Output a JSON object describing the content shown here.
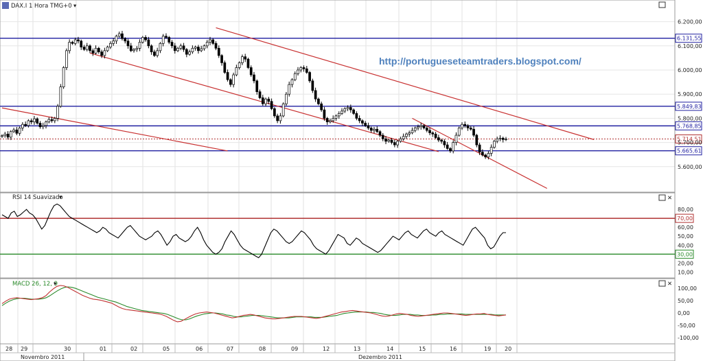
{
  "header": {
    "title": "DAX.I 1 Hora TMG+0",
    "watermark": "http://portugueseteamtraders.blogspot.com/"
  },
  "panels": {
    "price": {
      "y_min": 5500,
      "y_max": 6250,
      "ticks": [
        5600,
        5700,
        5800,
        5900,
        6000,
        6100,
        6200
      ],
      "tick_labels": [
        "5.600,00",
        "5.700,00",
        "5.800,00",
        "5.900,00",
        "6.000,00",
        "6.100,00",
        "6.200,00"
      ],
      "levels": [
        {
          "value": 6131.55,
          "label": "6.131,55",
          "color": "#1f1fa0",
          "style": "solid"
        },
        {
          "value": 5849.83,
          "label": "5.849,83",
          "color": "#1f1fa0",
          "style": "solid"
        },
        {
          "value": 5768.85,
          "label": "5.768,85",
          "color": "#1f1fa0",
          "style": "solid"
        },
        {
          "value": 5714.51,
          "label": "5.714,51",
          "color": "#b03030",
          "style": "dotted"
        },
        {
          "value": 5665.61,
          "label": "5.665,61",
          "color": "#1f1fa0",
          "style": "solid"
        }
      ],
      "trendlines": [
        {
          "from": {
            "t": 0,
            "y": 5843
          },
          "to": {
            "t": 77,
            "y": 5665
          }
        },
        {
          "from": {
            "t": 30,
            "y": 6070
          },
          "to": {
            "t": 149,
            "y": 5662
          }
        },
        {
          "from": {
            "t": 73,
            "y": 6175
          },
          "to": {
            "t": 202,
            "y": 5712
          }
        },
        {
          "from": {
            "t": 140,
            "y": 5800
          },
          "to": {
            "t": 186,
            "y": 5510
          }
        }
      ]
    },
    "rsi": {
      "title": "RSI 14 Suavizado",
      "y_min": 5,
      "y_max": 90,
      "ticks": [
        10,
        20,
        40,
        50,
        60,
        80
      ],
      "tick_labels": [
        "10,00",
        "20,00",
        "40,00",
        "50,00",
        "60,00",
        "80,00"
      ],
      "levels": [
        {
          "value": 70,
          "label": "70,00",
          "color": "#b03030"
        },
        {
          "value": 30,
          "label": "30,00",
          "color": "#2a8a2a"
        }
      ]
    },
    "macd": {
      "title": "MACD 26, 12, 9",
      "y_min": -120,
      "y_max": 120,
      "ticks": [
        -100,
        -50,
        0,
        50,
        100
      ],
      "tick_labels": [
        "-100,00",
        "-50,00",
        "0,00",
        "50,00",
        "100,00"
      ]
    }
  },
  "x_axis": {
    "days": [
      "28",
      "29",
      "30",
      "01",
      "02",
      "05",
      "06",
      "07",
      "08",
      "09",
      "12",
      "13",
      "14",
      "15",
      "16",
      "19",
      "20"
    ],
    "months": [
      "Novembro 2011",
      "Dezembro 2011"
    ]
  },
  "colors": {
    "up": "#ffffff",
    "down": "#000000",
    "level_blue": "#1f1fa0",
    "level_red": "#b03030",
    "macd": "#c03030",
    "signal": "#2a8a2a"
  },
  "chart_data": [
    {
      "type": "candlestick",
      "title": "DAX.I 1 Hora TMG+0",
      "ylim": [
        5500,
        6250
      ],
      "x_unit": "hourly bars",
      "close": [
        5728,
        5735,
        5722,
        5745,
        5752,
        5738,
        5760,
        5775,
        5770,
        5790,
        5785,
        5798,
        5780,
        5765,
        5770,
        5785,
        5795,
        5790,
        5800,
        5850,
        5930,
        6010,
        6080,
        6115,
        6110,
        6125,
        6120,
        6095,
        6085,
        6100,
        6080,
        6070,
        6090,
        6075,
        6060,
        6080,
        6095,
        6110,
        6120,
        6140,
        6150,
        6130,
        6120,
        6100,
        6080,
        6085,
        6090,
        6115,
        6135,
        6125,
        6100,
        6075,
        6060,
        6080,
        6110,
        6140,
        6135,
        6115,
        6100,
        6080,
        6090,
        6100,
        6085,
        6065,
        6075,
        6090,
        6095,
        6080,
        6088,
        6100,
        6115,
        6125,
        6110,
        6090,
        6060,
        6030,
        5990,
        5960,
        5940,
        5980,
        6010,
        6030,
        6055,
        6045,
        6010,
        5980,
        5955,
        5910,
        5885,
        5860,
        5880,
        5870,
        5840,
        5810,
        5790,
        5810,
        5860,
        5900,
        5940,
        5960,
        5985,
        6000,
        6010,
        6005,
        5990,
        5955,
        5915,
        5880,
        5860,
        5835,
        5800,
        5785,
        5790,
        5800,
        5810,
        5820,
        5830,
        5840,
        5845,
        5835,
        5820,
        5800,
        5790,
        5780,
        5770,
        5760,
        5750,
        5755,
        5745,
        5730,
        5715,
        5705,
        5710,
        5700,
        5690,
        5705,
        5715,
        5725,
        5735,
        5740,
        5750,
        5760,
        5765,
        5770,
        5760,
        5750,
        5740,
        5735,
        5720,
        5710,
        5705,
        5690,
        5675,
        5665,
        5700,
        5730,
        5760,
        5775,
        5770,
        5760,
        5755,
        5730,
        5690,
        5660,
        5648,
        5640,
        5655,
        5680,
        5705,
        5715,
        5718,
        5712,
        5714
      ],
      "open": [
        5725,
        5728,
        5735,
        5722,
        5745,
        5752,
        5738,
        5760,
        5775,
        5770,
        5790,
        5785,
        5798,
        5780,
        5765,
        5770,
        5785,
        5795,
        5790,
        5800,
        5850,
        5930,
        6010,
        6080,
        6115,
        6110,
        6125,
        6120,
        6095,
        6085,
        6100,
        6080,
        6070,
        6090,
        6075,
        6060,
        6080,
        6095,
        6110,
        6120,
        6140,
        6150,
        6130,
        6120,
        6100,
        6080,
        6085,
        6090,
        6115,
        6135,
        6125,
        6100,
        6075,
        6060,
        6080,
        6110,
        6140,
        6135,
        6115,
        6100,
        6080,
        6090,
        6100,
        6085,
        6065,
        6075,
        6090,
        6095,
        6080,
        6088,
        6100,
        6115,
        6125,
        6110,
        6090,
        6060,
        6030,
        5990,
        5960,
        5940,
        5980,
        6010,
        6030,
        6055,
        6045,
        6010,
        5980,
        5955,
        5910,
        5885,
        5860,
        5880,
        5870,
        5840,
        5810,
        5790,
        5810,
        5860,
        5900,
        5940,
        5960,
        5985,
        6000,
        6010,
        6005,
        5990,
        5955,
        5915,
        5880,
        5860,
        5835,
        5800,
        5785,
        5790,
        5800,
        5810,
        5820,
        5830,
        5840,
        5845,
        5835,
        5820,
        5800,
        5790,
        5780,
        5770,
        5760,
        5750,
        5755,
        5745,
        5730,
        5715,
        5705,
        5710,
        5700,
        5690,
        5705,
        5715,
        5725,
        5735,
        5740,
        5750,
        5760,
        5765,
        5770,
        5760,
        5750,
        5740,
        5735,
        5720,
        5710,
        5705,
        5690,
        5675,
        5665,
        5700,
        5730,
        5760,
        5775,
        5770,
        5760,
        5755,
        5730,
        5690,
        5660,
        5648,
        5640,
        5655,
        5680,
        5705,
        5715,
        5718,
        5712
      ]
    },
    {
      "type": "line",
      "title": "RSI 14 Suavizado",
      "ylim": [
        5,
        90
      ],
      "series": [
        {
          "values": [
            74,
            72,
            70,
            76,
            78,
            72,
            74,
            77,
            80,
            76,
            74,
            70,
            64,
            58,
            62,
            70,
            78,
            84,
            86,
            84,
            80,
            76,
            72,
            70,
            68,
            66,
            64,
            62,
            60,
            58,
            56,
            54,
            56,
            60,
            58,
            54,
            52,
            50,
            48,
            52,
            56,
            60,
            62,
            58,
            54,
            50,
            48,
            46,
            48,
            50,
            54,
            56,
            52,
            46,
            40,
            44,
            50,
            52,
            48,
            46,
            44,
            46,
            50,
            56,
            60,
            54,
            46,
            40,
            36,
            32,
            30,
            32,
            36,
            44,
            50,
            56,
            52,
            46,
            40,
            36,
            34,
            32,
            30,
            28,
            26,
            30,
            38,
            46,
            54,
            58,
            56,
            52,
            48,
            44,
            42,
            44,
            48,
            52,
            56,
            54,
            50,
            46,
            40,
            36,
            34,
            32,
            30,
            34,
            40,
            46,
            52,
            50,
            48,
            42,
            40,
            44,
            48,
            46,
            42,
            40,
            38,
            36,
            34,
            32,
            34,
            38,
            42,
            46,
            50,
            48,
            46,
            50,
            54,
            56,
            52,
            50,
            48,
            52,
            56,
            58,
            54,
            52,
            50,
            54,
            56,
            52,
            50,
            48,
            46,
            44,
            42,
            40,
            46,
            52,
            58,
            60,
            56,
            52,
            48,
            40,
            36,
            38,
            44,
            50,
            54,
            54
          ]
        }
      ]
    },
    {
      "type": "line",
      "title": "MACD 26, 12, 9",
      "ylim": [
        -120,
        120
      ],
      "series": [
        {
          "values": [
            38,
            48,
            56,
            60,
            62,
            60,
            58,
            56,
            54,
            56,
            58,
            62,
            70,
            85,
            98,
            108,
            112,
            110,
            104,
            96,
            88,
            80,
            72,
            66,
            60,
            56,
            54,
            52,
            48,
            44,
            40,
            32,
            24,
            18,
            14,
            12,
            10,
            8,
            6,
            4,
            2,
            0,
            -2,
            -4,
            -8,
            -14,
            -22,
            -30,
            -36,
            -34,
            -26,
            -18,
            -10,
            -4,
            0,
            2,
            4,
            2,
            0,
            -4,
            -8,
            -12,
            -16,
            -20,
            -18,
            -14,
            -10,
            -8,
            -6,
            -8,
            -12,
            -16,
            -20,
            -22,
            -24,
            -24,
            -22,
            -20,
            -18,
            -16,
            -14,
            -14,
            -14,
            -16,
            -18,
            -20,
            -22,
            -20,
            -16,
            -12,
            -8,
            -4,
            0,
            4,
            6,
            8,
            10,
            8,
            6,
            4,
            2,
            0,
            -4,
            -8,
            -12,
            -14,
            -12,
            -8,
            -4,
            -2,
            -4,
            -6,
            -10,
            -12,
            -14,
            -12,
            -10,
            -8,
            -6,
            -4,
            -2,
            0,
            0,
            -2,
            -4,
            -6,
            -8,
            -10,
            -8,
            -6,
            -4,
            -4,
            -2,
            -6,
            -8,
            -10,
            -12,
            -10,
            -8
          ]
        },
        {
          "values": [
            30,
            40,
            48,
            54,
            58,
            60,
            60,
            58,
            56,
            56,
            56,
            58,
            62,
            70,
            80,
            90,
            98,
            104,
            106,
            104,
            100,
            94,
            88,
            82,
            76,
            70,
            64,
            60,
            56,
            52,
            48,
            44,
            38,
            32,
            26,
            22,
            18,
            14,
            10,
            8,
            6,
            4,
            2,
            0,
            -2,
            -6,
            -12,
            -18,
            -24,
            -28,
            -28,
            -24,
            -18,
            -12,
            -8,
            -4,
            -2,
            0,
            0,
            -2,
            -4,
            -8,
            -10,
            -14,
            -16,
            -16,
            -14,
            -12,
            -10,
            -10,
            -10,
            -12,
            -14,
            -16,
            -18,
            -20,
            -20,
            -20,
            -20,
            -18,
            -16,
            -16,
            -16,
            -16,
            -16,
            -18,
            -18,
            -18,
            -16,
            -14,
            -12,
            -10,
            -6,
            -2,
            0,
            2,
            4,
            4,
            4,
            4,
            2,
            2,
            0,
            -2,
            -6,
            -8,
            -10,
            -10,
            -8,
            -6,
            -6,
            -6,
            -8,
            -8,
            -10,
            -10,
            -10,
            -8,
            -8,
            -6,
            -6,
            -4,
            -4,
            -4,
            -4,
            -4,
            -6,
            -6,
            -6,
            -6,
            -6,
            -6,
            -6,
            -6,
            -8,
            -8,
            -8,
            -8
          ]
        }
      ]
    }
  ]
}
